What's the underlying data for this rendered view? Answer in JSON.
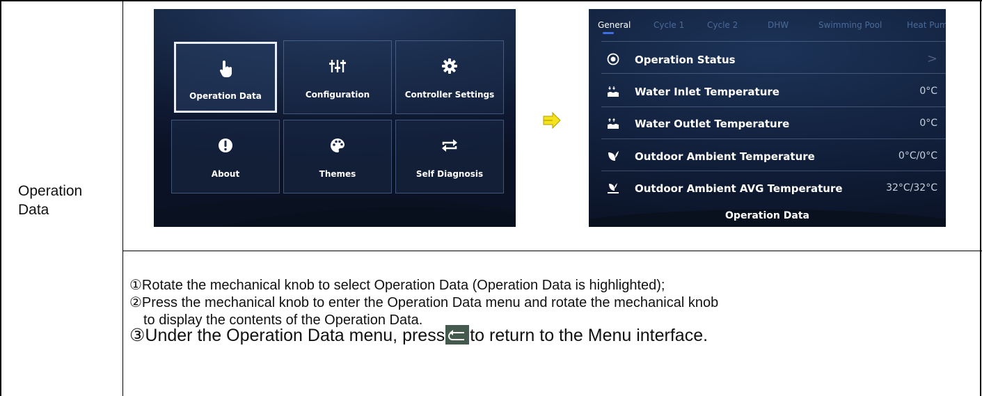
{
  "row_label": "Operation Data",
  "menu_screen": {
    "tiles": [
      {
        "label": "Operation Data",
        "icon": "hand-pointer-icon",
        "selected": true
      },
      {
        "label": "Configuration",
        "icon": "sliders-icon",
        "selected": false
      },
      {
        "label": "Controller Settings",
        "icon": "gear-icon",
        "selected": false
      },
      {
        "label": "About",
        "icon": "exclamation-circle-icon",
        "selected": false
      },
      {
        "label": "Themes",
        "icon": "palette-icon",
        "selected": false
      },
      {
        "label": "Self Diagnosis",
        "icon": "swap-arrows-icon",
        "selected": false
      }
    ]
  },
  "detail_screen": {
    "tabs": [
      "General",
      "Cycle 1",
      "Cycle 2",
      "DHW",
      "Swimming Pool",
      "Heat Pum"
    ],
    "active_tab": "General",
    "rows": [
      {
        "label": "Operation Status",
        "value": "",
        "icon": "radio-target-icon",
        "chevron": ">"
      },
      {
        "label": "Water Inlet Temperature",
        "value": "0°C",
        "icon": "water-inlet-icon"
      },
      {
        "label": "Water Outlet Temperature",
        "value": "0°C",
        "icon": "water-outlet-icon"
      },
      {
        "label": "Outdoor Ambient Temperature",
        "value": "0°C/0°C",
        "icon": "leaf-icon"
      },
      {
        "label": "Outdoor Ambient AVG Temperature",
        "value": "32°C/32°C",
        "icon": "leaf-avg-icon"
      }
    ],
    "footer_title": "Operation Data"
  },
  "instructions": {
    "step1": "①Rotate the mechanical knob to select Operation Data (Operation Data is highlighted);",
    "step2a": "②Press the mechanical knob to enter the Operation Data menu and rotate the mechanical knob",
    "step2b": "to display the contents of the Operation Data.",
    "step3_before": "③Under the Operation Data menu, press",
    "step3_after": "to return to the Menu interface."
  },
  "colors": {
    "accent": "#3e6fe0",
    "arrow": "#f4e21c",
    "back_button": "#455a4f"
  }
}
